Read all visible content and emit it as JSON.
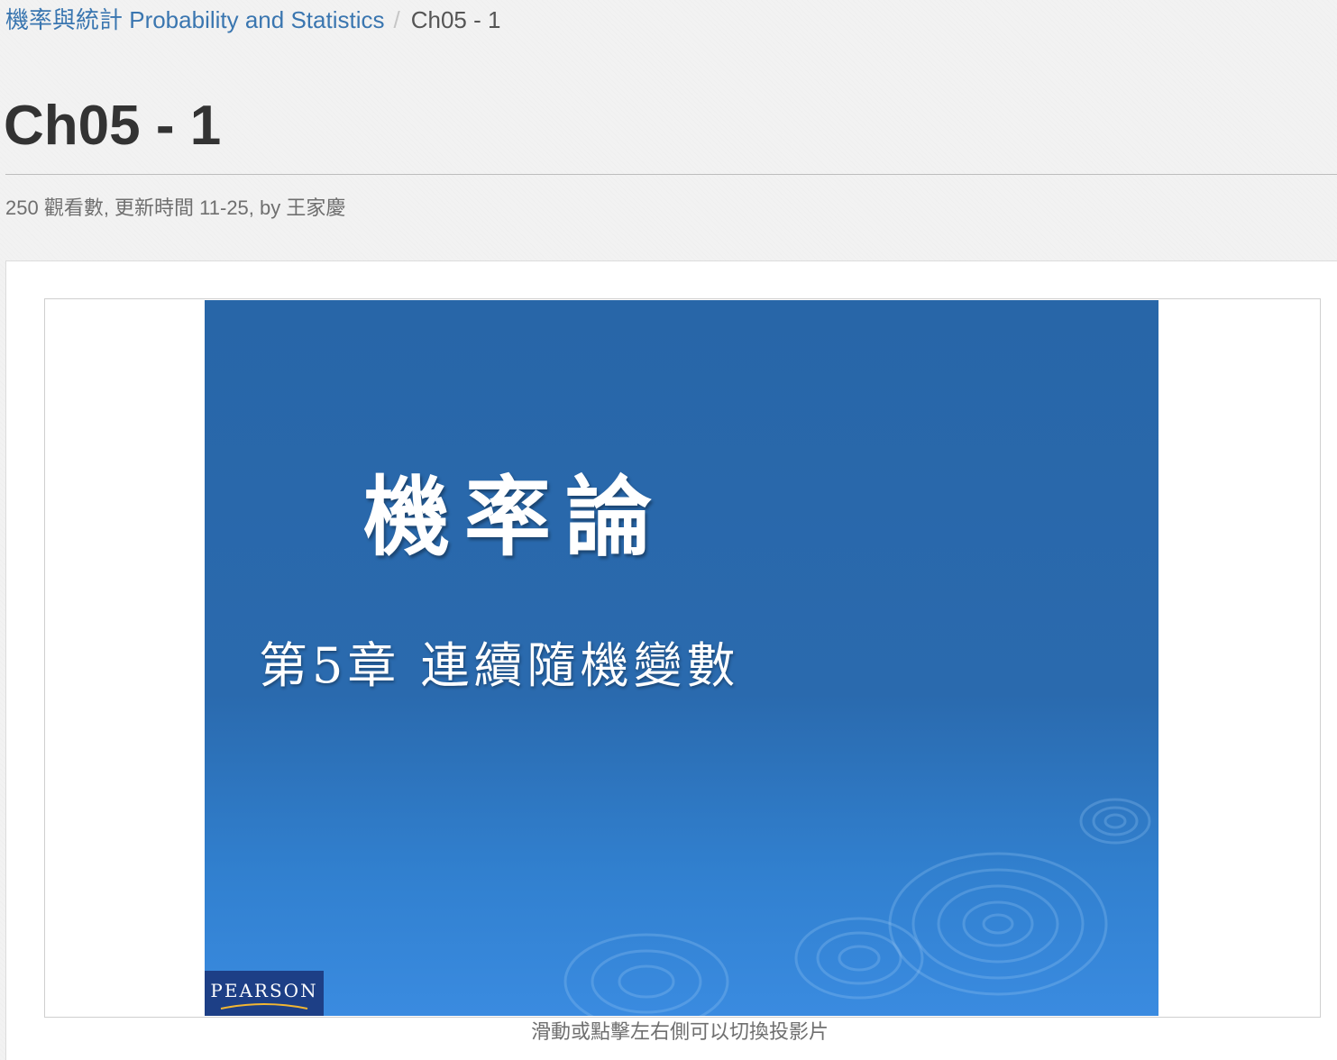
{
  "breadcrumb": {
    "course": "機率與統計 Probability and Statistics",
    "separator": "/",
    "current": "Ch05 - 1"
  },
  "page": {
    "title": "Ch05 - 1",
    "meta": "250 觀看數, 更新時間 11-25, by 王家慶"
  },
  "slide": {
    "title": "機率論",
    "subtitle": "第5章 連續隨機變數",
    "logo": "PEARSON"
  },
  "hint": "滑動或點擊左右側可以切換投影片",
  "colors": {
    "link": "#3a76b0",
    "slide_top": "#2866a8",
    "slide_bottom": "#3a8be0",
    "logo_bg": "#1d3f86"
  }
}
